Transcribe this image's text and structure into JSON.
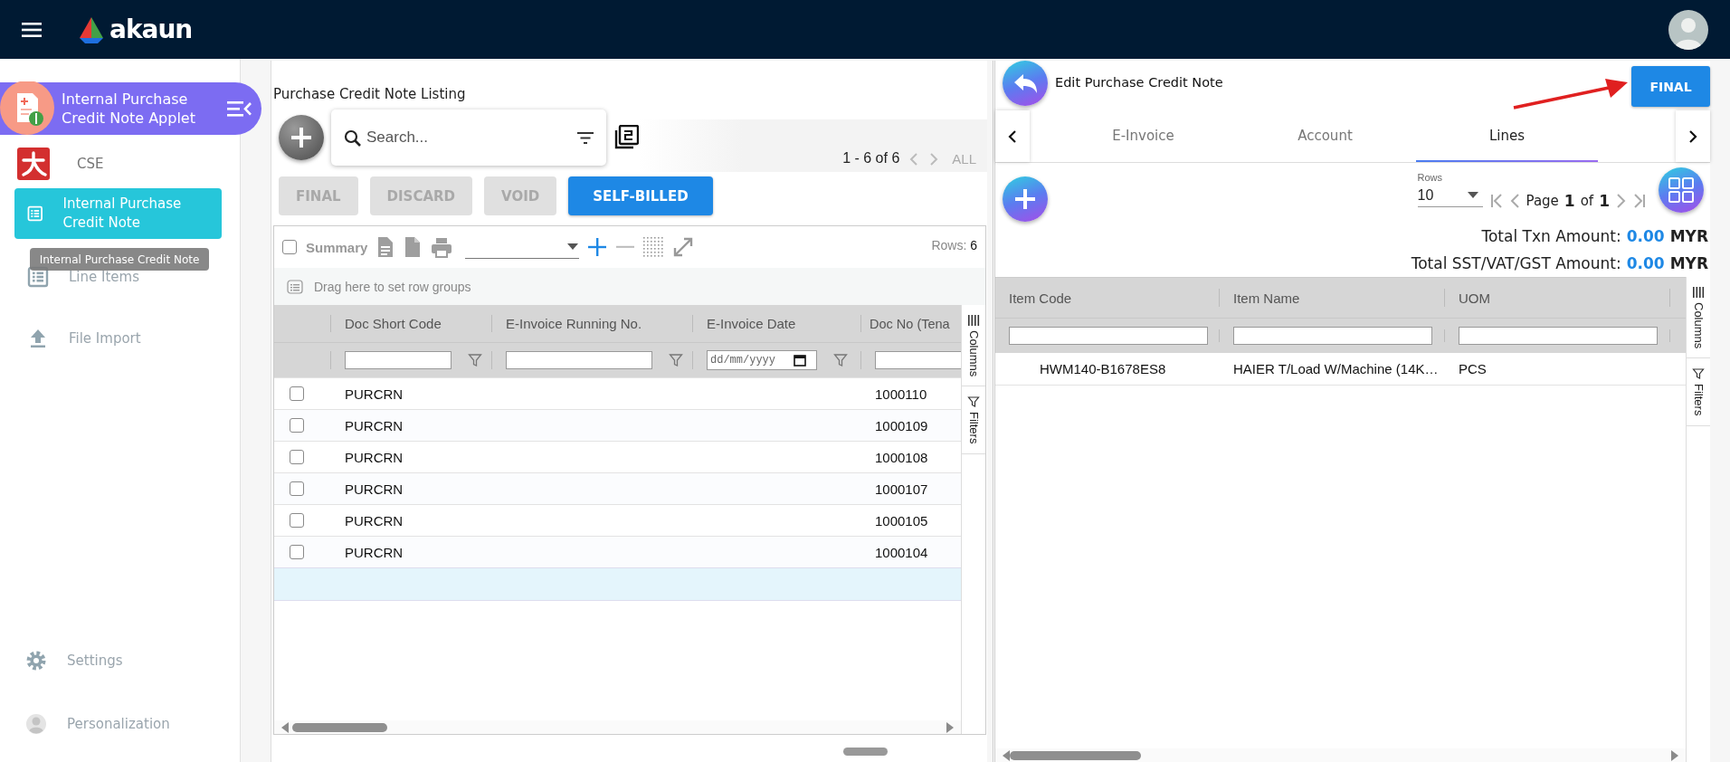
{
  "header": {
    "logo": "akaun"
  },
  "sidebar": {
    "applet": "Internal Purchase Credit Note Applet",
    "group": "CSE",
    "items": [
      {
        "kind": "list",
        "label": "Internal Purchase Credit Note",
        "selected": true
      },
      {
        "kind": "list",
        "label": "Line Items",
        "selected": false
      },
      {
        "kind": "upload",
        "label": "File Import",
        "selected": false
      }
    ],
    "tooltip": "Internal Purchase Credit Note",
    "footer": [
      {
        "kind": "gear",
        "label": "Settings"
      },
      {
        "kind": "person",
        "label": "Personalization"
      }
    ]
  },
  "listing": {
    "title": "Purchase Credit Note Listing",
    "search": {
      "placeholder": "Search..."
    },
    "range": "1 - 6 of 6",
    "all": "ALL",
    "actions": [
      {
        "label": "FINAL",
        "disabled": true
      },
      {
        "label": "DISCARD",
        "disabled": true
      },
      {
        "label": "VOID",
        "disabled": true
      },
      {
        "label": "SELF-BILLED",
        "disabled": false
      }
    ],
    "summary": {
      "label": "Summary",
      "checked": false
    },
    "rows_label": "Rows:",
    "rows_count": "6",
    "group_hint": "Drag here to set row groups",
    "columns": [
      {
        "label": "Doc Short Code",
        "kind": "text"
      },
      {
        "label": "E-Invoice Running No.",
        "kind": "text"
      },
      {
        "label": "E-Invoice Date",
        "kind": "date",
        "placeholder": "dd/mm/yyyy"
      },
      {
        "label": "Doc No (Tena",
        "kind": "text"
      }
    ],
    "rows": [
      {
        "checked": false,
        "doc_short_code": "PURCRN",
        "doc_no": "1000110"
      },
      {
        "checked": false,
        "doc_short_code": "PURCRN",
        "doc_no": "1000109"
      },
      {
        "checked": false,
        "doc_short_code": "PURCRN",
        "doc_no": "1000108"
      },
      {
        "checked": false,
        "doc_short_code": "PURCRN",
        "doc_no": "1000107"
      },
      {
        "checked": false,
        "doc_short_code": "PURCRN",
        "doc_no": "1000105"
      },
      {
        "checked": false,
        "doc_short_code": "PURCRN",
        "doc_no": "1000104"
      }
    ],
    "side_tabs": [
      "Columns",
      "Filters"
    ]
  },
  "editor": {
    "title": "Edit Purchase Credit Note",
    "final": "FINAL",
    "tabs": [
      {
        "label": "E-Invoice",
        "selected": false
      },
      {
        "label": "Account",
        "selected": false
      },
      {
        "label": "Lines",
        "selected": true
      }
    ],
    "rows_label": "Rows",
    "page_size": "10",
    "page_label": "Page",
    "page": "1",
    "of": "of",
    "pages": "1",
    "totals": [
      {
        "label": "Total Txn Amount:",
        "amount": "0.00",
        "currency": "MYR"
      },
      {
        "label": "Total SST/VAT/GST Amount:",
        "amount": "0.00",
        "currency": "MYR"
      }
    ],
    "columns": [
      "Item Code",
      "Item Name",
      "UOM"
    ],
    "rows": [
      {
        "cells": [
          "HWM140-B1678ES8",
          "HAIER T/Load W/Machine (14K…",
          "PCS"
        ]
      }
    ],
    "side_tabs": [
      "Columns",
      "Filters"
    ]
  }
}
